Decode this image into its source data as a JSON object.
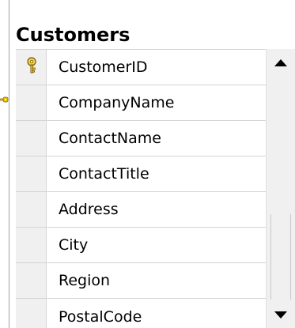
{
  "table": {
    "title": "Customers",
    "columns": [
      {
        "name": "CustomerID",
        "primary_key": true,
        "icon": "primary-key-icon"
      },
      {
        "name": "CompanyName",
        "primary_key": false
      },
      {
        "name": "ContactName",
        "primary_key": false
      },
      {
        "name": "ContactTitle",
        "primary_key": false
      },
      {
        "name": "Address",
        "primary_key": false
      },
      {
        "name": "City",
        "primary_key": false
      },
      {
        "name": "Region",
        "primary_key": false
      },
      {
        "name": "PostalCode",
        "primary_key": false
      }
    ]
  },
  "scrollbar": {
    "up_icon": "scroll-up-arrow-icon",
    "down_icon": "scroll-down-arrow-icon"
  },
  "connector": {
    "icon": "relationship-key-icon",
    "color": "#e8c400"
  },
  "colors": {
    "key_gold": "#d4a400",
    "border": "#d4d4d4",
    "selector_bg": "#f0f0f0"
  }
}
